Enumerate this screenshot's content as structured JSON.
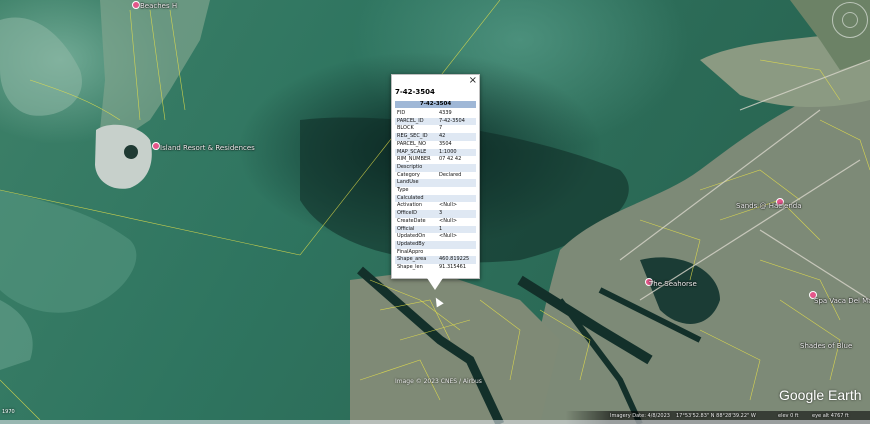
{
  "map": {
    "labels": {
      "beaches": "Beaches H",
      "island_resort": "Island Resort & Residences",
      "sands_hacienda": "Sands @ Hacienda",
      "seahorse": "The Seahorse",
      "drive_right": "Spa Vaca Del Ma",
      "shades_of_blue": "Shades of Blue"
    }
  },
  "popup": {
    "title": "7-42-3504",
    "header": "7-42-3504",
    "rows": [
      {
        "key": "FID",
        "value": "4339"
      },
      {
        "key": "PARCEL_ID",
        "value": "7-42-3504"
      },
      {
        "key": "BLOCK",
        "value": "7"
      },
      {
        "key": "REG_SEC_ID",
        "value": "42"
      },
      {
        "key": "PARCEL_NO",
        "value": "3504"
      },
      {
        "key": "MAP_SCALE",
        "value": "1:1000"
      },
      {
        "key": "RIM_NUMBER",
        "value": "07 42 42"
      },
      {
        "key": "Descriptio",
        "value": ""
      },
      {
        "key": "Category",
        "value": "Declared"
      },
      {
        "key": "LandUse",
        "value": ""
      },
      {
        "key": "Type",
        "value": ""
      },
      {
        "key": "Calculated",
        "value": ""
      },
      {
        "key": "Activation",
        "value": "<Null>"
      },
      {
        "key": "OfficeID",
        "value": "3"
      },
      {
        "key": "CreateDate",
        "value": "<Null>"
      },
      {
        "key": "Official",
        "value": "1"
      },
      {
        "key": "UpdatedOn",
        "value": "<Null>"
      },
      {
        "key": "UpdatedBy",
        "value": ""
      },
      {
        "key": "FinalAppro",
        "value": ""
      },
      {
        "key": "Shape_area",
        "value": "460.819225"
      },
      {
        "key": "Shape_len",
        "value": "91.315461"
      }
    ],
    "close_glyph": "×"
  },
  "overlay": {
    "copyright": "Image © 2023 CNES / Airbus",
    "logo": "Google Earth",
    "scale_left": "1970",
    "imagery_date": "Imagery Date: 4/8/2023",
    "coords": "17°53'52.83\" N  88°28'39.22\" W",
    "elev": "elev  0 ft",
    "eye_alt": "eye alt  4767 ft"
  }
}
